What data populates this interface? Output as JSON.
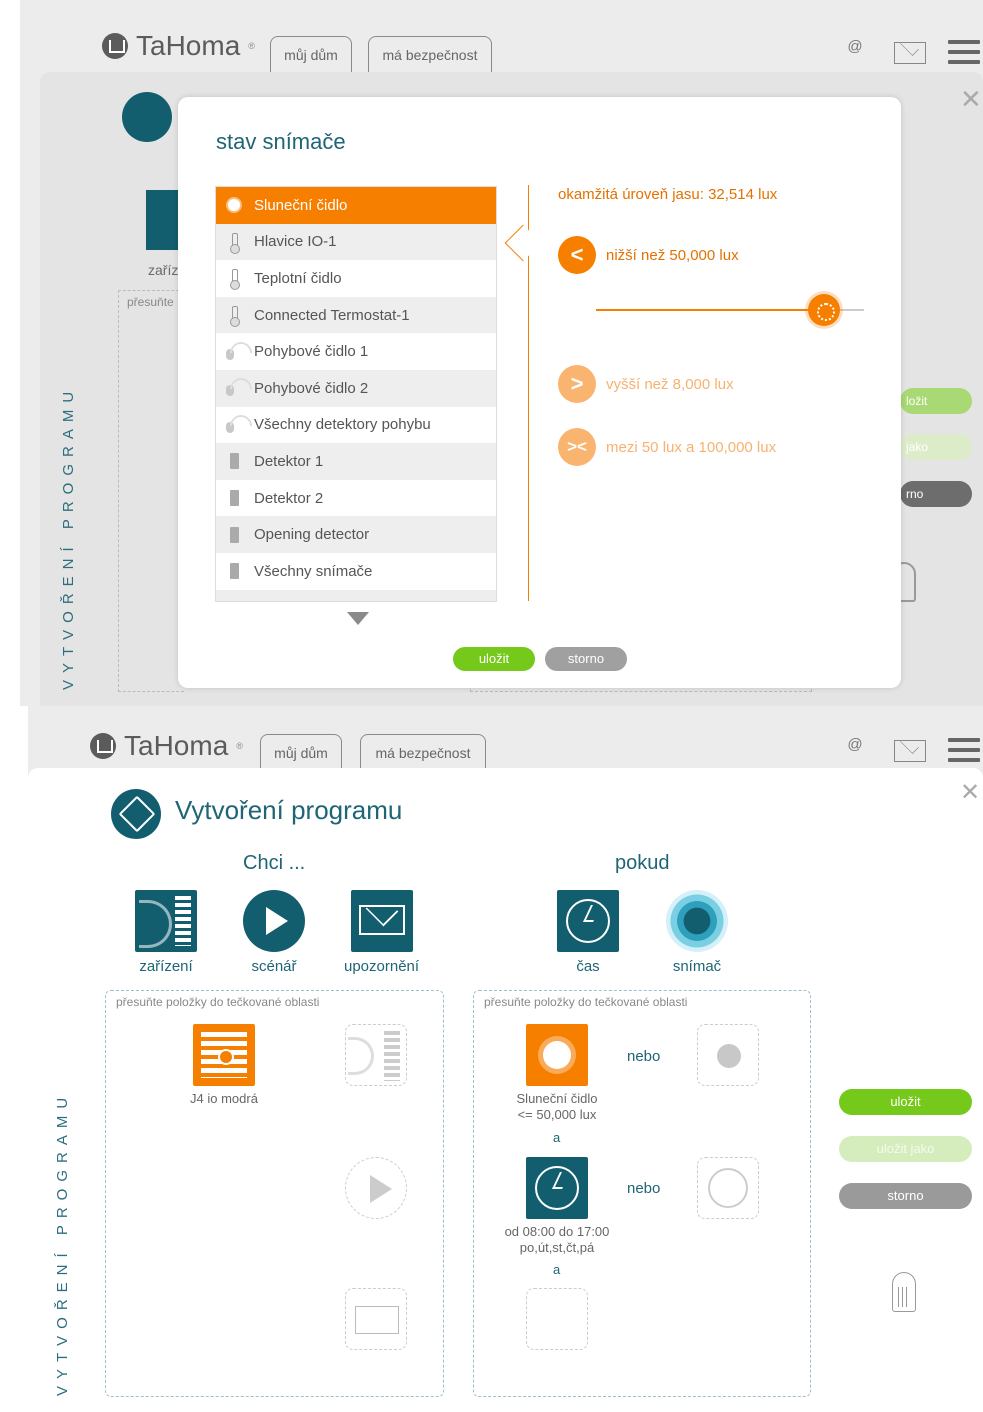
{
  "app": {
    "logo": "TaHoma",
    "logo_reg": "®",
    "tabs": [
      "můj dům",
      "má bezpečnost"
    ],
    "at_icon": "@"
  },
  "dialog": {
    "title": "stav snímače",
    "sensors": [
      {
        "label": "Sluneční čidlo",
        "icon": "sun-icon",
        "active": true
      },
      {
        "label": "Hlavice IO-1",
        "icon": "thermometer-icon"
      },
      {
        "label": "Teplotní čidlo",
        "icon": "thermometer-icon"
      },
      {
        "label": "Connected Termostat-1",
        "icon": "thermometer-icon"
      },
      {
        "label": "Pohybové čidlo 1",
        "icon": "motion-sensor-icon"
      },
      {
        "label": "Pohybové čidlo 2",
        "icon": "motion-sensor-icon"
      },
      {
        "label": "Všechny detektory pohybu",
        "icon": "motion-sensor-icon"
      },
      {
        "label": "Detektor 1",
        "icon": "door-icon"
      },
      {
        "label": "Detektor 2",
        "icon": "door-icon"
      },
      {
        "label": "Opening detector",
        "icon": "door-icon"
      },
      {
        "label": "Všechny snímače",
        "icon": "door-icon"
      }
    ],
    "current_level": "okamžitá úroveň jasu: 32,514 lux",
    "cond_lower": "nižší než 50,000 lux",
    "cond_higher": "vyšší než 8,000 lux",
    "cond_between": "mezi 50 lux a 100,000 lux",
    "cond_lower_symbol": "<",
    "cond_higher_symbol": ">",
    "cond_between_symbol": "><",
    "slider_level": 0.85,
    "save": "uložit",
    "cancel": "storno"
  },
  "background_dimmed": {
    "device_label": "zaříz",
    "dropzone_hint": "přesuňte",
    "buttons": [
      "uložit",
      "uložit jako",
      "storno"
    ],
    "vertical_label": "VYTVOŘENÍ PROGRAMU"
  },
  "program": {
    "title": "Vytvoření programu",
    "want_heading": "Chci ...",
    "if_heading": "pokud",
    "want_items": [
      {
        "label": "zařízení",
        "icon": "device-icon"
      },
      {
        "label": "scénář",
        "icon": "play-icon"
      },
      {
        "label": "upozornění",
        "icon": "mail-icon"
      }
    ],
    "if_items": [
      {
        "label": "čas",
        "icon": "clock-icon"
      },
      {
        "label": "snímač",
        "icon": "sensor-icon"
      }
    ],
    "dropzone_hint": "přesuňte položky do tečkované oblasti",
    "action_item": "J4 io modrá",
    "condition_sensor_line1": "Sluneční čidlo",
    "condition_sensor_line2": "<= 50,000 lux",
    "condition_time_line1": "od 08:00 do 17:00",
    "condition_time_line2": "po,út,st,čt,pá",
    "and_label": "a",
    "or_label": "nebo",
    "vertical_label": "VYTVOŘENÍ PROGRAMU",
    "save": "uložit",
    "save_as": "uložit jako",
    "cancel": "storno"
  },
  "colors": {
    "accent_orange": "#f77f00",
    "primary_teal": "#135e6e",
    "save_green": "#75c91a",
    "cancel_grey": "#9a9a9a"
  }
}
